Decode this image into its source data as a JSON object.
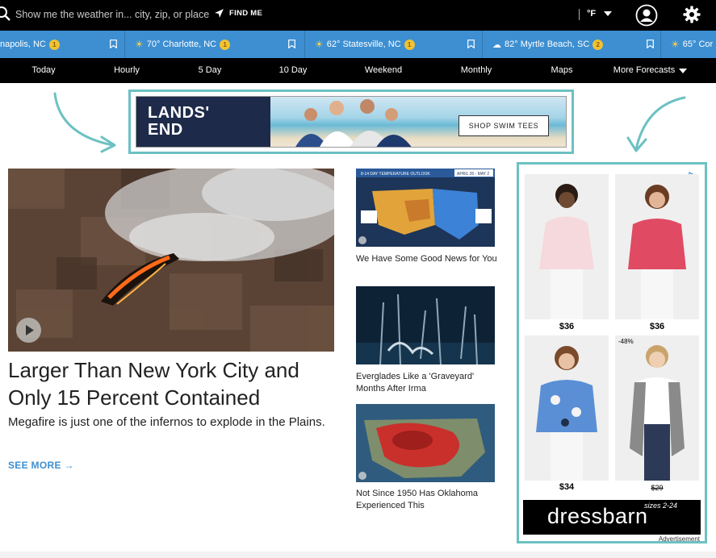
{
  "search": {
    "placeholder": "Show me the weather in... city, zip, or place",
    "find_me": "FIND ME"
  },
  "units": {
    "label": "°F"
  },
  "locations": [
    {
      "label": "napolis, NC",
      "icon": "sun-icon",
      "badge": "1"
    },
    {
      "label": "70° Charlotte, NC",
      "icon": "sun-icon",
      "badge": "1"
    },
    {
      "label": "62° Statesville, NC",
      "icon": "sun-icon",
      "badge": "1"
    },
    {
      "label": "82° Myrtle Beach, SC",
      "icon": "cloud-icon",
      "badge": "2"
    },
    {
      "label": "65° Cor",
      "icon": "sun-icon",
      "badge": ""
    }
  ],
  "nav": [
    "Today",
    "Hourly",
    "5 Day",
    "10 Day",
    "Weekend",
    "Monthly",
    "Maps",
    "More Forecasts"
  ],
  "banner_ad": {
    "brand_line1": "LANDS'",
    "brand_line2": "END",
    "cta": "SHOP SWIM TEES"
  },
  "hero": {
    "title": "Larger Than New York City and Only 15 Percent Contained",
    "description": "Megafire is just one of the infernos to explode in the Plains.",
    "see_more": "SEE MORE →"
  },
  "stories": [
    {
      "title": "We Have Some Good News for You",
      "thumb_caption": "8-14 DAY TEMPERATURE OUTLOOK",
      "thumb_dates": "APRIL 26 - MAY 2"
    },
    {
      "title": "Everglades Like a 'Graveyard' Months After Irma"
    },
    {
      "title": "Not Since 1950 Has Oklahoma Experienced This"
    }
  ],
  "side_ad": {
    "prices": [
      "$36",
      "$36",
      "$34",
      "$29"
    ],
    "discount": "-48%",
    "brand": "dressbarn",
    "sizes": "sizes 2-24",
    "label": "Advertisement"
  },
  "colors": {
    "accent": "#3d8fd1",
    "ad_frame": "#6cc1c3",
    "topbar": "#000000"
  }
}
